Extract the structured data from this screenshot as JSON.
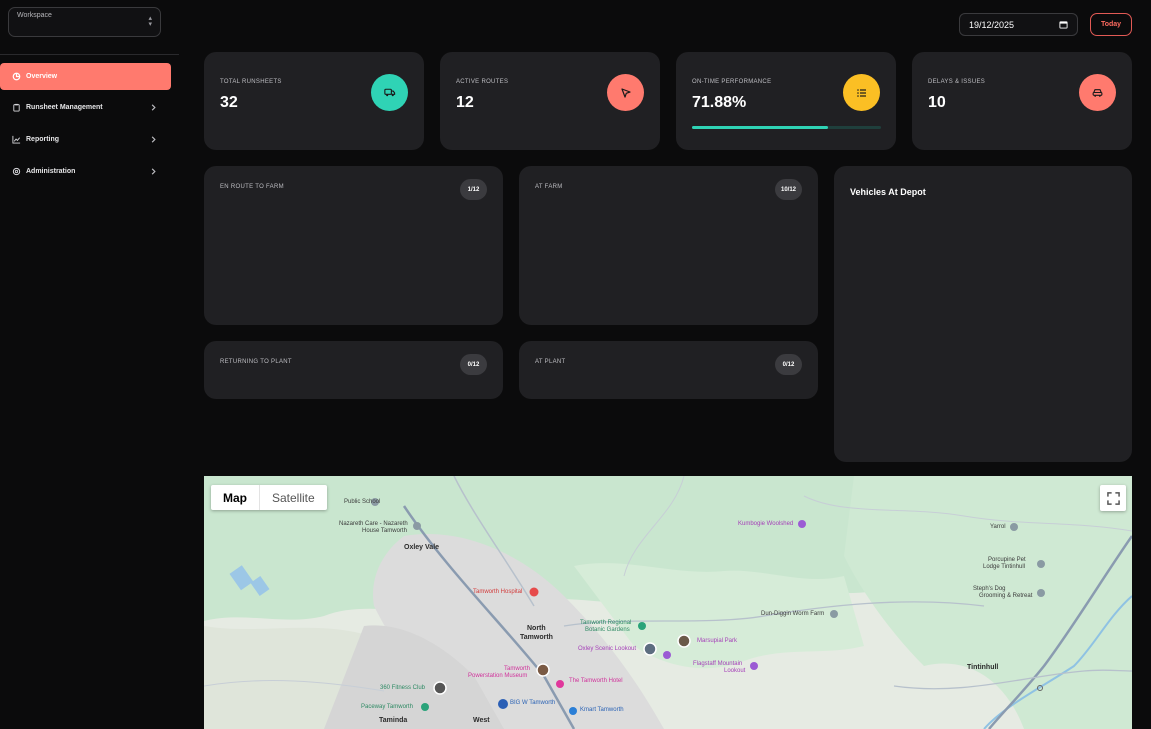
{
  "sidebar": {
    "workspace_label": "Workspace",
    "items": [
      {
        "label": "Overview",
        "icon": "pie-chart-icon"
      },
      {
        "label": "Runsheet Management",
        "icon": "clipboard-icon"
      },
      {
        "label": "Reporting",
        "icon": "trend-chart-icon"
      },
      {
        "label": "Administration",
        "icon": "gear-icon"
      }
    ]
  },
  "header": {
    "date_value": "19/12/2025",
    "today_label": "Today"
  },
  "stats": [
    {
      "label": "TOTAL RUNSHEETS",
      "value": "32",
      "icon": "truck-icon",
      "color": "#2fd3b5"
    },
    {
      "label": "ACTIVE ROUTES",
      "value": "12",
      "icon": "navigation-icon",
      "color": "#ff7a6e"
    },
    {
      "label": "ON-TIME PERFORMANCE",
      "value": "71.88%",
      "icon": "list-icon",
      "color": "#fbbf24",
      "progress": 0.7188
    },
    {
      "label": "DELAYS & ISSUES",
      "value": "10",
      "icon": "car-icon",
      "color": "#ff7a6e"
    }
  ],
  "panels": {
    "en_route": {
      "title": "EN ROUTE TO FARM",
      "badge": "1/12"
    },
    "at_farm": {
      "title": "AT FARM",
      "badge": "10/12"
    },
    "returning": {
      "title": "RETURNING TO PLANT",
      "badge": "0/12"
    },
    "at_plant": {
      "title": "AT PLANT",
      "badge": "0/12"
    },
    "depot": {
      "title": "Vehicles At Depot"
    }
  },
  "map": {
    "tabs": [
      "Map",
      "Satellite"
    ],
    "active_tab": "Map",
    "labels": {
      "public_school": "Public School",
      "nazareth_1": "Nazareth Care - Nazareth",
      "nazareth_2": "House Tamworth",
      "oxley_vale": "Oxley Vale",
      "tamworth_hospital": "Tamworth Hospital",
      "north_tamworth_1": "North",
      "north_tamworth_2": "Tamworth",
      "botanic_1": "Tamworth Regional",
      "botanic_2": "Botanic Gardens",
      "oxley_lookout": "Oxley Scenic Lookout",
      "marsupial_park": "Marsupial Park",
      "flagstaff_1": "Flagstaff Mountain",
      "flagstaff_2": "Lookout",
      "powerstation_1": "Tamworth",
      "powerstation_2": "Powerstation Museum",
      "tamworth_hotel": "The Tamworth Hotel",
      "fitness_club": "360 Fitness Club",
      "paceway": "Paceway Tamworth",
      "big_w": "BIG W Tamworth",
      "kmart": "Kmart Tamworth",
      "taminda": "Taminda",
      "west": "West",
      "kumbogie": "Kumbogie Woolshed",
      "dun_diggin": "Dun-Diggin Worm Farm",
      "yarrol": "Yarrol",
      "porcupine_1": "Porcupine Pet",
      "porcupine_2": "Lodge Tintinhull",
      "stephs_1": "Steph's Dog",
      "stephs_2": "Grooming & Retreat",
      "tintinhull": "Tintinhull"
    }
  }
}
